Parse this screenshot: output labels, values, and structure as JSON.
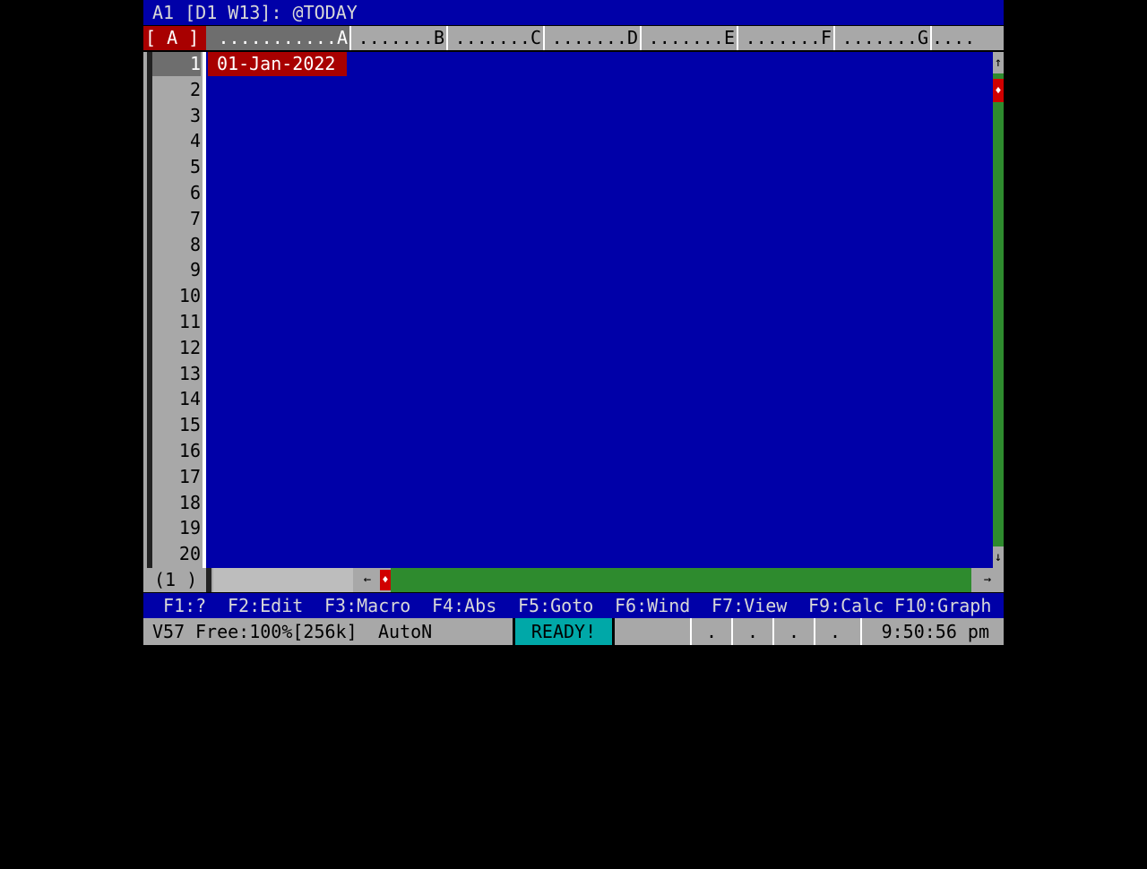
{
  "top_line": "A1 [D1 W13]: @TODAY",
  "corner_label": "[ A ]",
  "columns": [
    {
      "label": "...........A"
    },
    {
      "label": ".......B"
    },
    {
      "label": ".......C"
    },
    {
      "label": ".......D"
    },
    {
      "label": ".......E"
    },
    {
      "label": ".......F"
    },
    {
      "label": ".......G"
    },
    {
      "label": "...."
    }
  ],
  "rows": [
    "1",
    "2",
    "3",
    "4",
    "5",
    "6",
    "7",
    "8",
    "9",
    "10",
    "11",
    "12",
    "13",
    "14",
    "15",
    "16",
    "17",
    "18",
    "19",
    "20"
  ],
  "active_cell": {
    "value": "01-Jan-2022"
  },
  "window_label": "(1 )",
  "scroll_icons": {
    "up": "↑",
    "down": "↓",
    "left": "←",
    "right": "→",
    "thumb": "♦"
  },
  "function_keys": [
    "F1:?",
    "F2:Edit",
    "F3:Macro",
    "F4:Abs",
    "F5:Goto",
    "F6:Wind",
    "F7:View",
    "F9:Calc",
    "F10:Graph"
  ],
  "status": {
    "version": "V57",
    "free": "Free:100%[256k]",
    "calc_mode": "AutoN",
    "mode": "READY!",
    "indicators": [
      ".",
      ".",
      ".",
      "."
    ],
    "clock": "9:50:56 pm"
  },
  "colors": {
    "background_blue": "#0000a8",
    "header_gray": "#a8a8a8",
    "cursor_red": "#a80000",
    "scroll_green": "#2e8b2e",
    "ready_cyan": "#00a8a8"
  }
}
